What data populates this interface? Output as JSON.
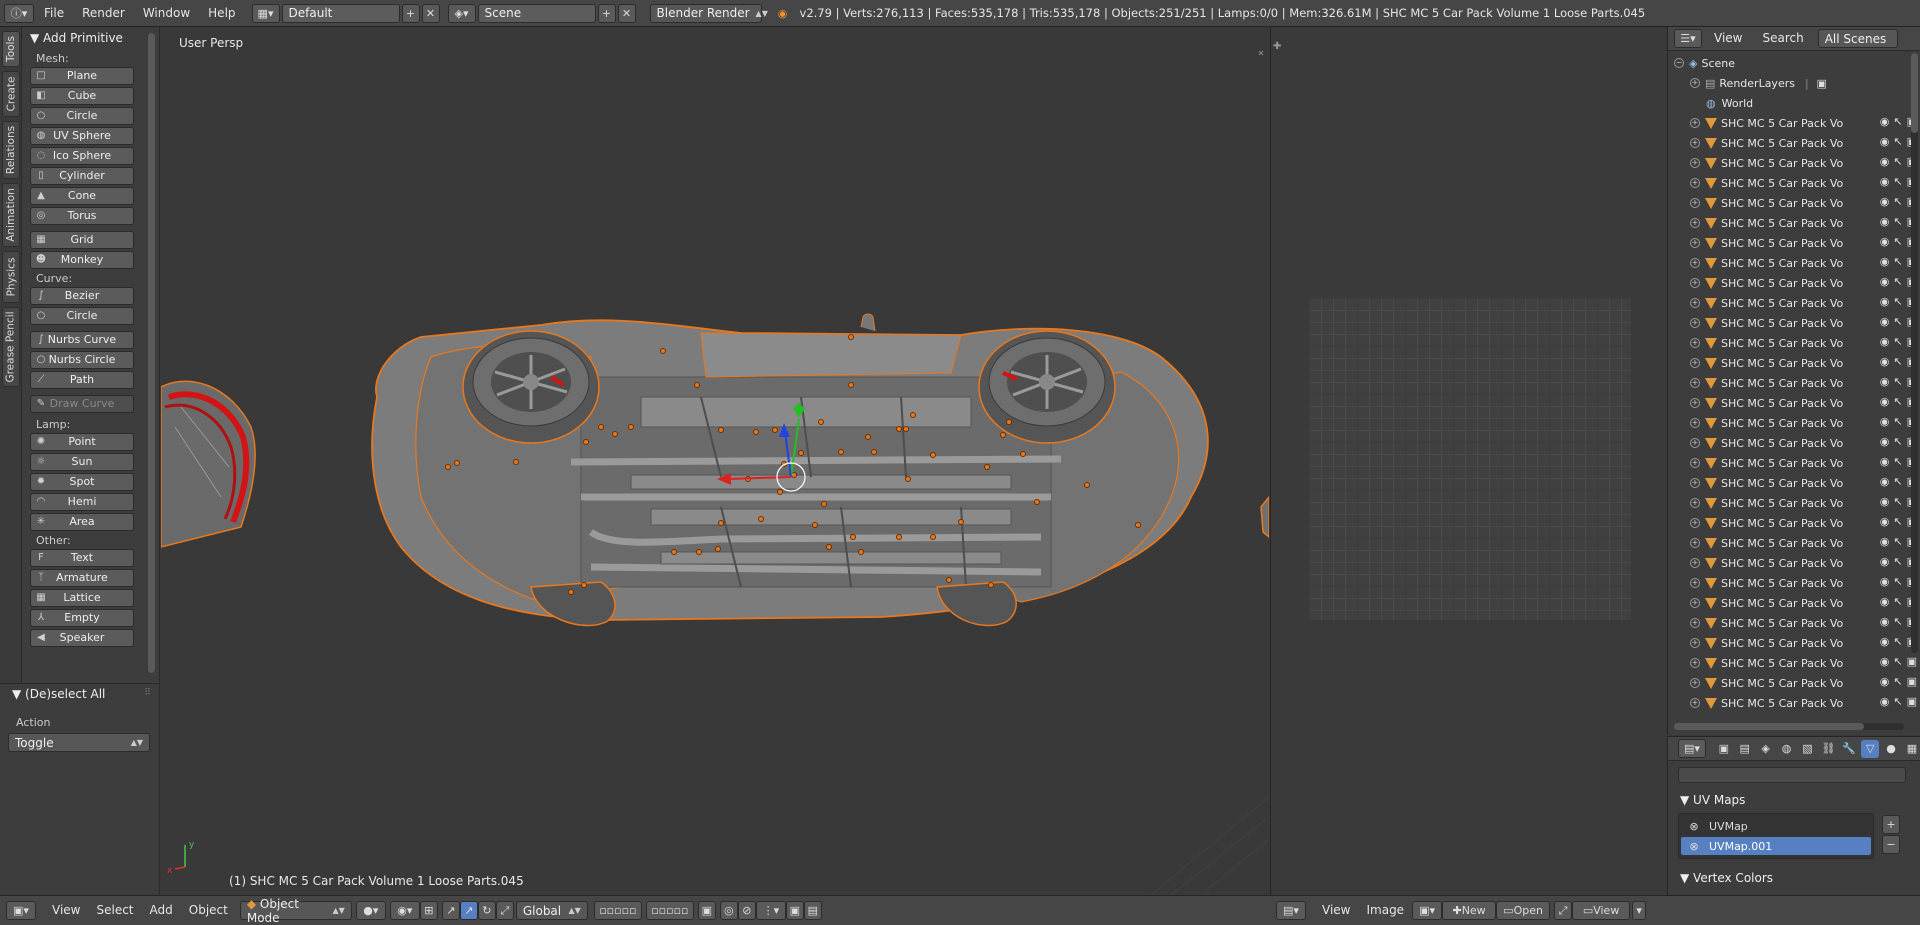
{
  "topbar": {
    "menus": [
      "File",
      "Render",
      "Window",
      "Help"
    ],
    "layout": "Default",
    "scene": "Scene",
    "engine": "Blender Render",
    "stats": "v2.79 | Verts:276,113 | Faces:535,178 | Tris:535,178 | Objects:251/251 | Lamps:0/0 | Mem:326.61M | SHC MC 5 Car Pack Volume 1 Loose Parts.045"
  },
  "tabs": [
    "Tools",
    "Create",
    "Relations",
    "Animation",
    "Physics",
    "Grease Pencil"
  ],
  "toolshelf": {
    "title": "Add Primitive",
    "mesh_label": "Mesh:",
    "mesh": [
      "Plane",
      "Cube",
      "Circle",
      "UV Sphere",
      "Ico Sphere",
      "Cylinder",
      "Cone",
      "Torus"
    ],
    "mesh2": [
      "Grid",
      "Monkey"
    ],
    "curve_label": "Curve:",
    "curve": [
      "Bezier",
      "Circle"
    ],
    "curve2": [
      "Nurbs Curve",
      "Nurbs Circle",
      "Path"
    ],
    "draw_curve": "Draw Curve",
    "lamp_label": "Lamp:",
    "lamp": [
      "Point",
      "Sun",
      "Spot",
      "Hemi",
      "Area"
    ],
    "other_label": "Other:",
    "other": [
      "Text",
      "Armature",
      "Lattice",
      "Empty",
      "Speaker"
    ]
  },
  "operator": {
    "title": "(De)select All",
    "action_label": "Action",
    "action_value": "Toggle"
  },
  "viewport": {
    "label": "User Persp",
    "object_info": "(1) SHC MC 5 Car Pack Volume 1 Loose Parts.045",
    "axis_x": "x",
    "axis_y": "y"
  },
  "outliner": {
    "header": [
      "View",
      "Search"
    ],
    "filter": "All Scenes",
    "scene": "Scene",
    "renderlayers": "RenderLayers",
    "world": "World",
    "object_name": "SHC MC 5 Car Pack Vo",
    "object_count_visible": 30
  },
  "properties": {
    "uvmaps_title": "UV Maps",
    "uvmaps": [
      "UVMap",
      "UVMap.001"
    ],
    "vertex_colors_title": "Vertex Colors"
  },
  "bottombar": {
    "menus": [
      "View",
      "Select",
      "Add",
      "Object"
    ],
    "mode": "Object Mode",
    "orientation": "Global",
    "image_menus": [
      "View",
      "Image"
    ],
    "new_label": "New",
    "open_label": "Open",
    "outliner_view": "View"
  },
  "colors": {
    "select_outline": "#e8781e",
    "selected_row": "#5680c2",
    "obj_icon": "#e09a3c",
    "red_wheel": "#d41414"
  }
}
